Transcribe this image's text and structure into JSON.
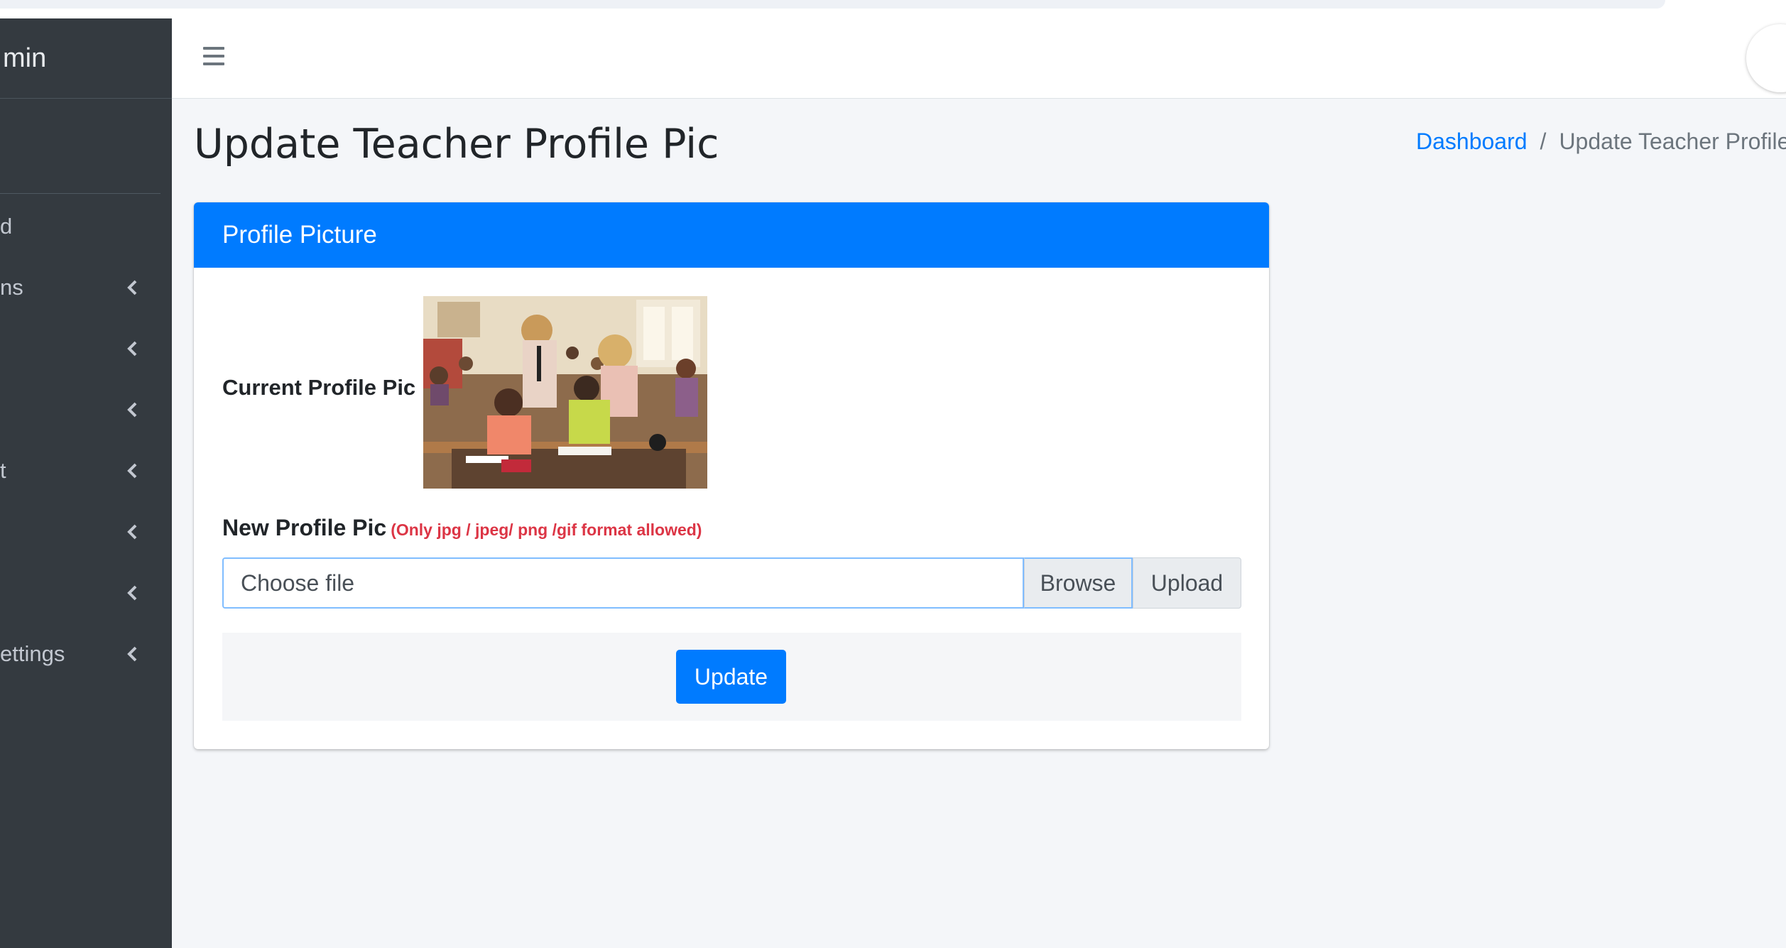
{
  "sidebar": {
    "brand": "min",
    "items": [
      {
        "label": "d",
        "chevron": false
      },
      {
        "label": "ns",
        "chevron": true
      },
      {
        "label": "",
        "chevron": true
      },
      {
        "label": "",
        "chevron": true
      },
      {
        "label": "t",
        "chevron": true
      },
      {
        "label": "",
        "chevron": true
      },
      {
        "label": "",
        "chevron": true
      },
      {
        "label": "ettings",
        "chevron": true
      }
    ]
  },
  "topbar": {
    "menu_icon": "hamburger-icon"
  },
  "page": {
    "title": "Update Teacher Profile Pic"
  },
  "breadcrumb": {
    "home": "Dashboard",
    "separator": "/",
    "current": "Update Teacher Profile"
  },
  "card": {
    "header": "Profile Picture",
    "current_label": "Current Profile Pic",
    "new_label": "New Profile Pic",
    "format_note": "(Only jpg / jpeg/ png /gif format allowed)",
    "file_placeholder": "Choose file",
    "browse_label": "Browse",
    "upload_label": "Upload",
    "update_label": "Update"
  },
  "colors": {
    "primary": "#007bff",
    "sidebar_bg": "#343a40",
    "danger": "#dc3545",
    "page_bg": "#f4f6f9"
  }
}
